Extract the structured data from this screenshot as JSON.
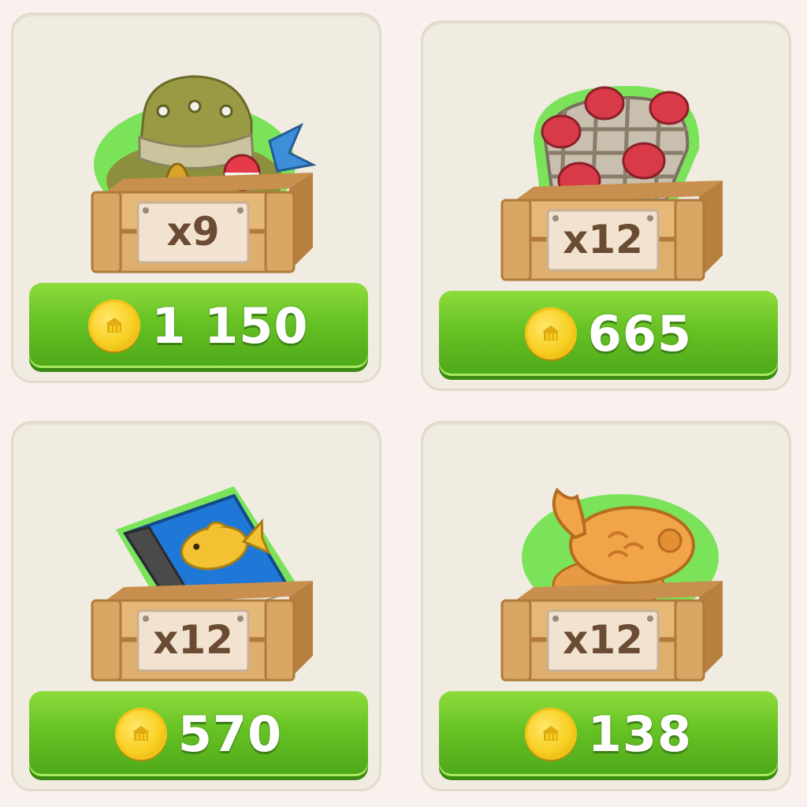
{
  "shop": {
    "items": [
      {
        "icon": "fishing-hat-icon",
        "quantity": "x9",
        "price": "1 150"
      },
      {
        "icon": "fishing-net-icon",
        "quantity": "x12",
        "price": "665"
      },
      {
        "icon": "fish-book-icon",
        "quantity": "x12",
        "price": "570"
      },
      {
        "icon": "fish-cookie-icon",
        "quantity": "x12",
        "price": "138"
      }
    ],
    "colors": {
      "button_green": "#66c224",
      "coin_gold": "#f8cf21",
      "crate_wood": "#e0b071",
      "card_bg": "#f0ece2",
      "selection_glow": "#7be35a"
    }
  }
}
